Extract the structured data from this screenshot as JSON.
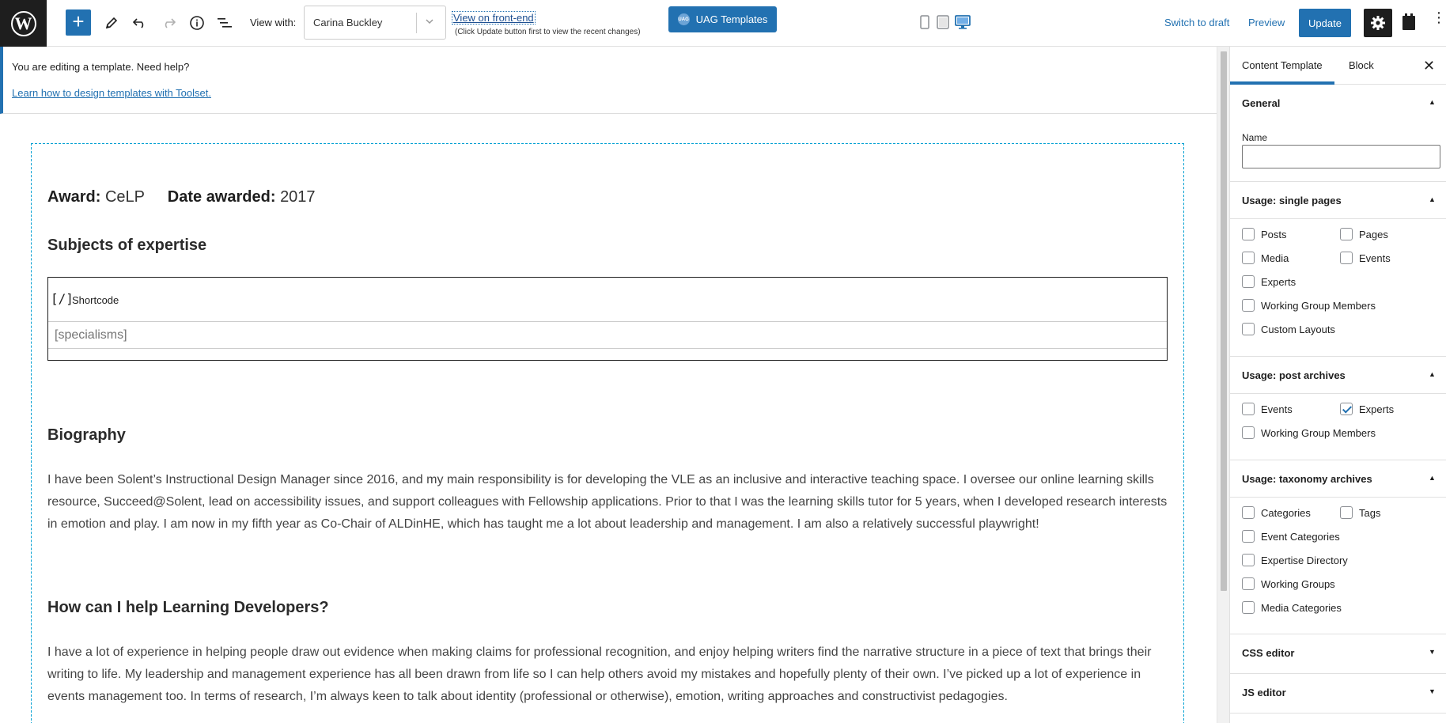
{
  "toolbar": {
    "view_with_label": "View with:",
    "view_with_value": "Carina Buckley",
    "view_frontend_link": "View on front-end",
    "view_frontend_note": "(Click Update button first to view the recent changes)",
    "uag_button": "UAG Templates",
    "uag_icon_text": "UAG",
    "switch_to_draft": "Switch to draft",
    "preview": "Preview",
    "update": "Update",
    "accent_color": "#2271b1"
  },
  "notice": {
    "text": "You are editing a template. Need help?",
    "link": "Learn how to design templates with Toolset."
  },
  "content": {
    "award_label": "Award:",
    "award_value": "CeLP",
    "date_label": "Date awarded:",
    "date_value": "2017",
    "subjects_heading": "Subjects of expertise",
    "shortcode_icon": "[/]",
    "shortcode_label": "Shortcode",
    "shortcode_value": "[specialisms]",
    "biography_heading": "Biography",
    "biography_text": "I have been Solent’s Instructional Design Manager since 2016, and my main responsibility is for developing the VLE as an inclusive and interactive teaching space. I oversee our online learning skills resource, Succeed@Solent, lead on accessibility issues, and support colleagues with Fellowship applications. Prior to that I was the learning skills tutor for 5 years, when I developed research interests in emotion and play. I am now in my fifth year as Co-Chair of ALDinHE, which has taught me a lot about leadership and management. I am also a relatively successful playwright!",
    "help_heading": "How can I help Learning Developers?",
    "help_text": "I have a lot of experience in helping people draw out evidence when making claims for professional recognition, and enjoy helping writers find the narrative structure in a piece of text that brings their writing to life. My leadership and management experience has all been drawn from life so I can help others avoid my mistakes and hopefully plenty of their own. I’ve picked up a lot of experience in events management too. In terms of research, I’m always keen to talk about identity (professional or otherwise), emotion, writing approaches and constructivist pedagogies."
  },
  "sidebar": {
    "tab_template": "Content Template",
    "tab_block": "Block",
    "close": "✕",
    "general": {
      "title": "General",
      "name_label": "Name",
      "name_value": ""
    },
    "single_pages": {
      "title": "Usage: single pages",
      "items": [
        {
          "label": "Posts",
          "checked": false
        },
        {
          "label": "Pages",
          "checked": false
        },
        {
          "label": "Media",
          "checked": false
        },
        {
          "label": "Events",
          "checked": false
        },
        {
          "label": "Experts",
          "checked": false
        },
        {
          "label": "Working Group Members",
          "checked": false
        },
        {
          "label": "Custom Layouts",
          "checked": false
        }
      ]
    },
    "post_archives": {
      "title": "Usage: post archives",
      "items": [
        {
          "label": "Events",
          "checked": false
        },
        {
          "label": "Experts",
          "checked": true
        },
        {
          "label": "Working Group Members",
          "checked": false
        }
      ]
    },
    "taxonomy_archives": {
      "title": "Usage: taxonomy archives",
      "items": [
        {
          "label": "Categories",
          "checked": false
        },
        {
          "label": "Tags",
          "checked": false
        },
        {
          "label": "Event Categories",
          "checked": false
        },
        {
          "label": "Expertise Directory",
          "checked": false
        },
        {
          "label": "Working Groups",
          "checked": false
        },
        {
          "label": "Media Categories",
          "checked": false
        }
      ]
    },
    "css_editor": "CSS editor",
    "js_editor": "JS editor"
  }
}
